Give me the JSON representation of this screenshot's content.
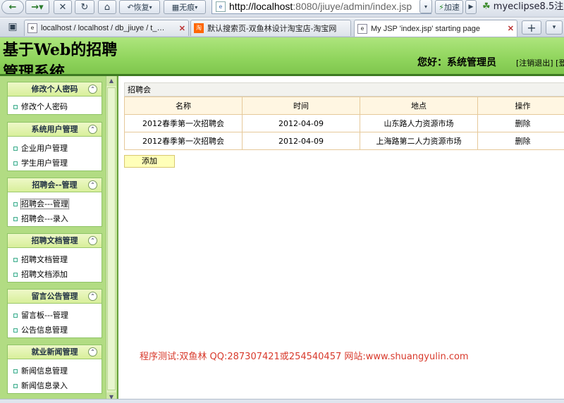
{
  "browser": {
    "back_icon": "back-arrow-icon",
    "forward_icon": "forward-arrow-icon",
    "restore_label": "恢复",
    "noshadow_label": "无痕",
    "url_host": "http://localhost",
    "url_rest": ":8080/jiuye/admin/index.jsp",
    "accelerate_label": "加速",
    "bookmark_label": "myeclipse8.5注"
  },
  "tabs": [
    {
      "title": "localhost / localhost / db_jiuye / t_…",
      "active": false
    },
    {
      "title": "默认搜索页-双鱼林设计淘宝店-淘宝网",
      "active": false
    },
    {
      "title": "My JSP 'index.jsp' starting page",
      "active": true
    }
  ],
  "header": {
    "title_line1": "基于Web的招聘",
    "title_line2": "管理系统",
    "greeting": "您好：系统管理员",
    "logout": "[注销退出]",
    "extra": "[登"
  },
  "sidebar": {
    "groups": [
      {
        "title": "修改个人密码",
        "items": [
          "修改个人密码"
        ]
      },
      {
        "title": "系统用户管理",
        "items": [
          "企业用户管理",
          "学生用户管理"
        ]
      },
      {
        "title": "招聘会--管理",
        "items": [
          "招聘会---管理",
          "招聘会---录入"
        ]
      },
      {
        "title": "招聘文档管理",
        "items": [
          "招聘文档管理",
          "招聘文档添加"
        ]
      },
      {
        "title": "留言公告管理",
        "items": [
          "留言板---管理",
          "公告信息管理"
        ]
      },
      {
        "title": "就业新闻管理",
        "items": [
          "新闻信息管理",
          "新闻信息录入"
        ]
      }
    ]
  },
  "main": {
    "panel_title": "招聘会",
    "columns": [
      "名称",
      "时间",
      "地点",
      "操作"
    ],
    "rows": [
      [
        "2012春季第一次招聘会",
        "2012-04-09",
        "山东路人力资源市场",
        "删除"
      ],
      [
        "2012春季第一次招聘会",
        "2012-04-09",
        "上海路第二人力资源市场",
        "删除"
      ]
    ],
    "add_label": "添加",
    "footer_note": "程序测试:双鱼林 QQ:287307421或254540457 网站:www.shuangyulin.com"
  }
}
